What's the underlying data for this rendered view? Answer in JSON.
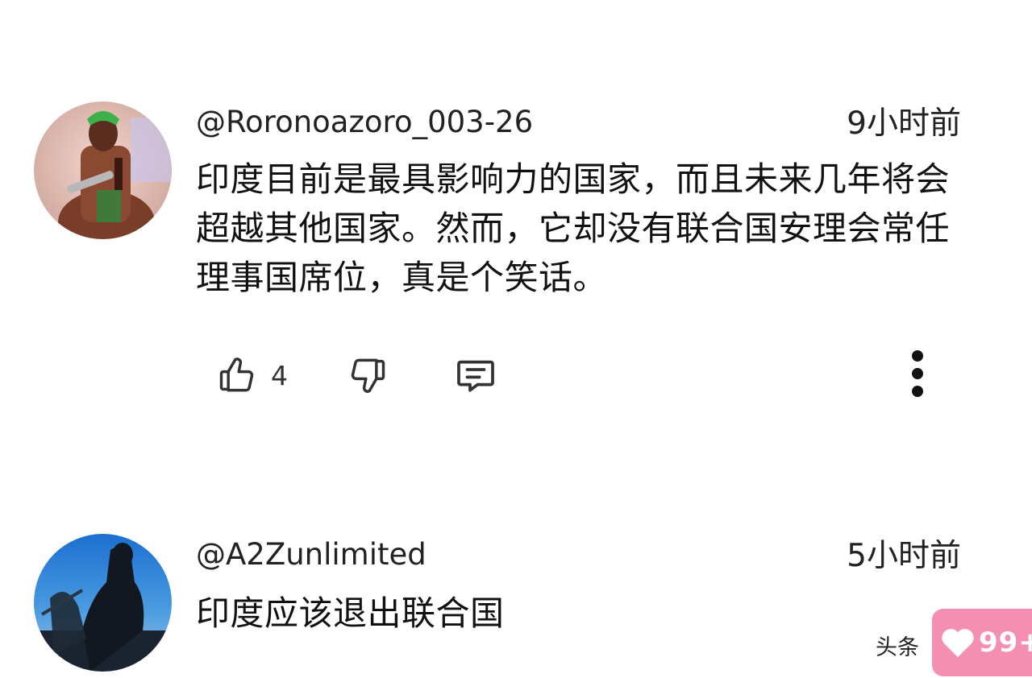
{
  "comments": [
    {
      "avatar_icon": "anime-character-avatar",
      "username": "@Roronoazoro_003-26",
      "time": "9小时前",
      "text": "印度目前是最具影响力的国家，而且未来几年将会超越其他国家。然而，它却没有联合国安理会常任理事国席位，真是个笑话。",
      "likes": "4",
      "icons": {
        "like": "thumbs-up-icon",
        "dislike": "thumbs-down-icon",
        "reply": "reply-comment-icon",
        "more": "more-vertical-icon"
      }
    },
    {
      "avatar_icon": "silhouette-photo-avatar",
      "username": "@A2Zunlimited",
      "time": "5小时前",
      "text": "印度应该退出联合国"
    }
  ],
  "watermark": "头条",
  "likes_badge": {
    "icon": "heart-icon",
    "count": "99+",
    "color": "#f48fb1"
  }
}
